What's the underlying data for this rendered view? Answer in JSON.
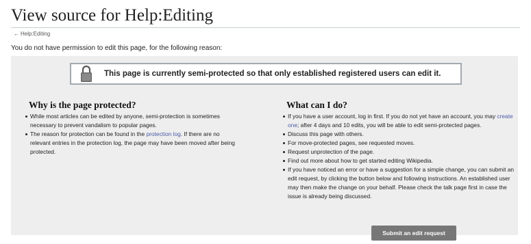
{
  "page": {
    "title": "View source for Help:Editing",
    "back_arrow": "←",
    "back_link": "Help:Editing",
    "reason": "You do not have permission to edit this page, for the following reason:"
  },
  "notice": {
    "icon": "lock-icon",
    "message": "This page is currently semi-protected so that only established registered users can edit it."
  },
  "left_column": {
    "heading": "Why is the page protected?",
    "item1": "While most articles can be edited by anyone, semi-protection is sometimes necessary to prevent vandalism to popular pages.",
    "item2_before": "The reason for protection can be found in the ",
    "item2_link": "protection log",
    "item2_after": ". If there are no relevant entries in the protection log, the page may have been moved after being protected."
  },
  "right_column": {
    "heading": "What can I do?",
    "item1_a": "If you have a user account, log in first. If you do not yet have an account, you may ",
    "item1_link": "create one",
    "item1_b": "; after 4 days and 10 edits, you will be able to edit semi-protected pages.",
    "item2": "Discuss this page with others.",
    "item3": "For move-protected pages, see requested moves.",
    "item4": "Request unprotection of the page.",
    "item5": "Find out more about how to get started editing Wikipedia.",
    "item6": "If you have noticed an error or have a suggestion for a simple change, you can submit an edit request, by clicking the button below and following instructions. An established user may then make the change on your behalf. Please check the talk page first in case the issue is already being discussed."
  },
  "button": {
    "submit_label": "Submit an edit request"
  },
  "colors": {
    "notice_background": "#eeeeee",
    "notice_border": "#a2a9b1",
    "button_background": "#777777",
    "link": "#4a5aa8"
  }
}
